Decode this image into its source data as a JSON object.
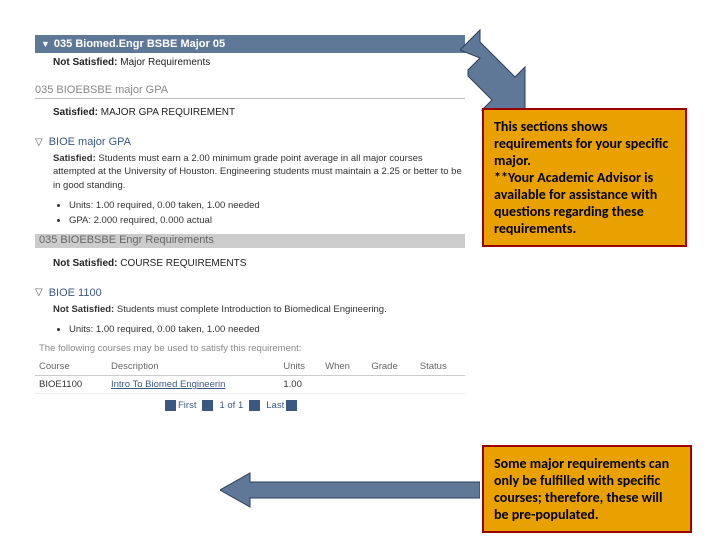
{
  "header": {
    "title": "035 Biomed.Engr BSBE Major 05"
  },
  "section1": {
    "not_satisfied_label": "Not Satisfied:",
    "not_satisfied_text": "Major Requirements"
  },
  "section2": {
    "title": "035 BIOEBSBE major GPA",
    "satisfied_label": "Satisfied:",
    "satisfied_text": "MAJOR GPA REQUIREMENT",
    "toggle_title": "BIOE major GPA",
    "body_satisfied_label": "Satisfied:",
    "body_satisfied_text": "Students must earn a 2.00 minimum grade point average in all major courses attempted at the University of Houston. Engineering students must maintain a 2.25 or better to be in good standing.",
    "bullets": [
      "Units: 1.00 required, 0.00 taken, 1.00 needed",
      "GPA: 2.000 required, 0.000 actual"
    ]
  },
  "section3": {
    "title": "035 BIOEBSBE Engr Requirements",
    "not_satisfied_label": "Not Satisfied:",
    "not_satisfied_text": "COURSE REQUIREMENTS",
    "toggle_title": "BIOE 1100",
    "body_not_satisfied_label": "Not Satisfied:",
    "body_not_satisfied_text": "Students must complete Introduction to Biomedical Engineering.",
    "bullets": [
      "Units: 1.00 required, 0.00 taken, 1.00 needed"
    ],
    "note": "The following courses may be used to satisfy this requirement:",
    "table": {
      "headers": [
        "Course",
        "Description",
        "Units",
        "When",
        "Grade",
        "Status"
      ],
      "rows": [
        {
          "course": "BIOE1100",
          "desc": "Intro To Biomed Engineerin",
          "units": "1.00",
          "when": "",
          "grade": "",
          "status": ""
        }
      ]
    },
    "pager": {
      "first": "First",
      "pos": "1 of 1",
      "last": "Last"
    }
  },
  "callout1": "This sections shows requirements for your specific major.\n**Your Academic Advisor is available for assistance with questions regarding these requirements.",
  "callout2": "Some major requirements can only be fulfilled with specific courses; therefore, these will be pre-populated."
}
